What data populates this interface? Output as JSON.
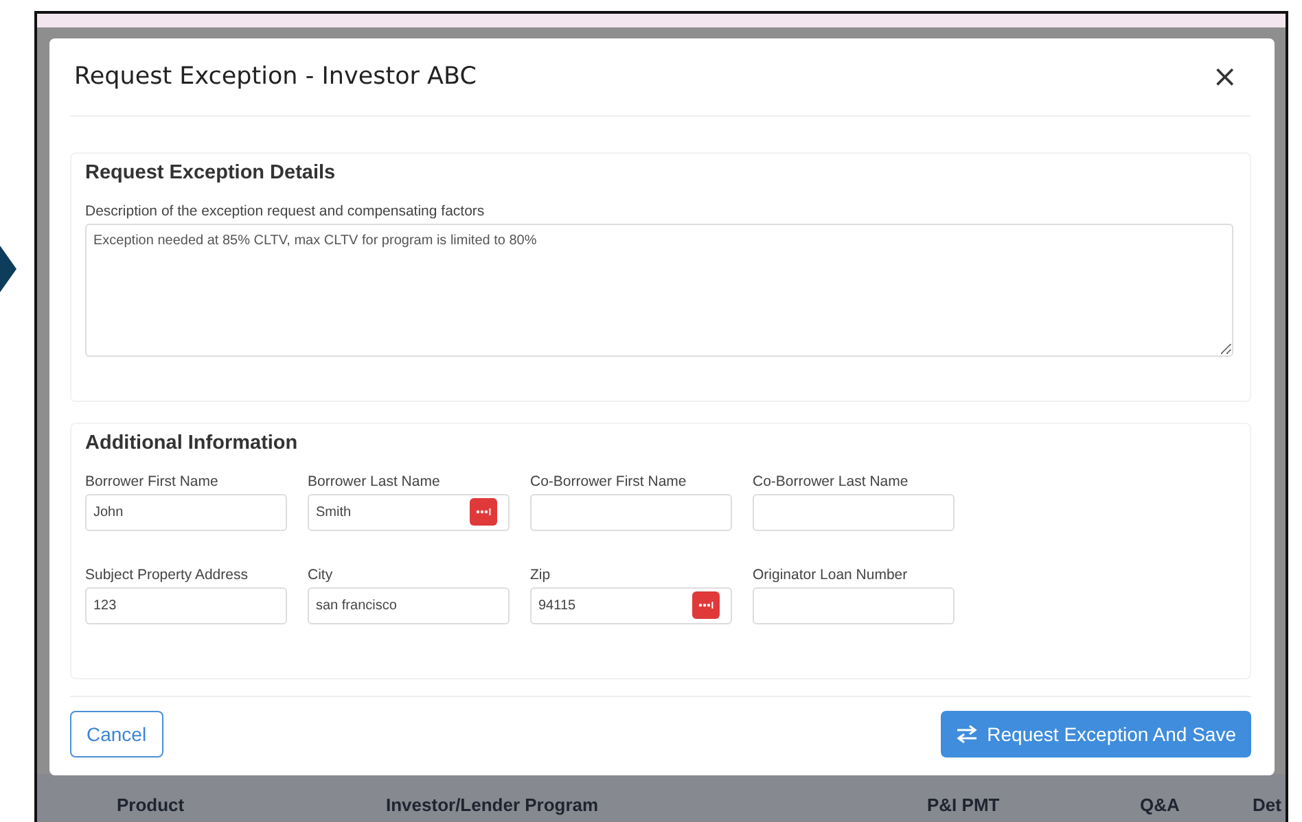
{
  "modal": {
    "title": "Request Exception - Investor ABC",
    "close": "×",
    "details": {
      "title": "Request Exception Details",
      "label": "Description of the exception request and compensating factors",
      "value": "Exception needed at 85% CLTV, max CLTV for program is limited to 80%"
    },
    "additional": {
      "title": "Additional Information",
      "fields": [
        {
          "label": "Borrower First Name",
          "value": "John",
          "action_button": false
        },
        {
          "label": "Borrower Last Name",
          "value": "Smith",
          "action_button": true
        },
        {
          "label": "Co-Borrower First Name",
          "action_button": false
        },
        {
          "label": "Co-Borrower Last Name",
          "action_button": false
        },
        {
          "label": "Subject Property Address",
          "value": "123",
          "action_button": false
        },
        {
          "label": "City",
          "value": "san francisco",
          "action_button": false
        },
        {
          "label": "Zip",
          "value": "94115",
          "action_button": true
        },
        {
          "label": "Originator Loan Number",
          "action_button": false
        }
      ]
    },
    "buttons": {
      "cancel": "Cancel",
      "submit": "Request Exception And Save"
    }
  },
  "background_table": {
    "columns": [
      "Product",
      "Investor/Lender Program",
      "P&I PMT",
      "Q&A",
      "Det"
    ]
  }
}
